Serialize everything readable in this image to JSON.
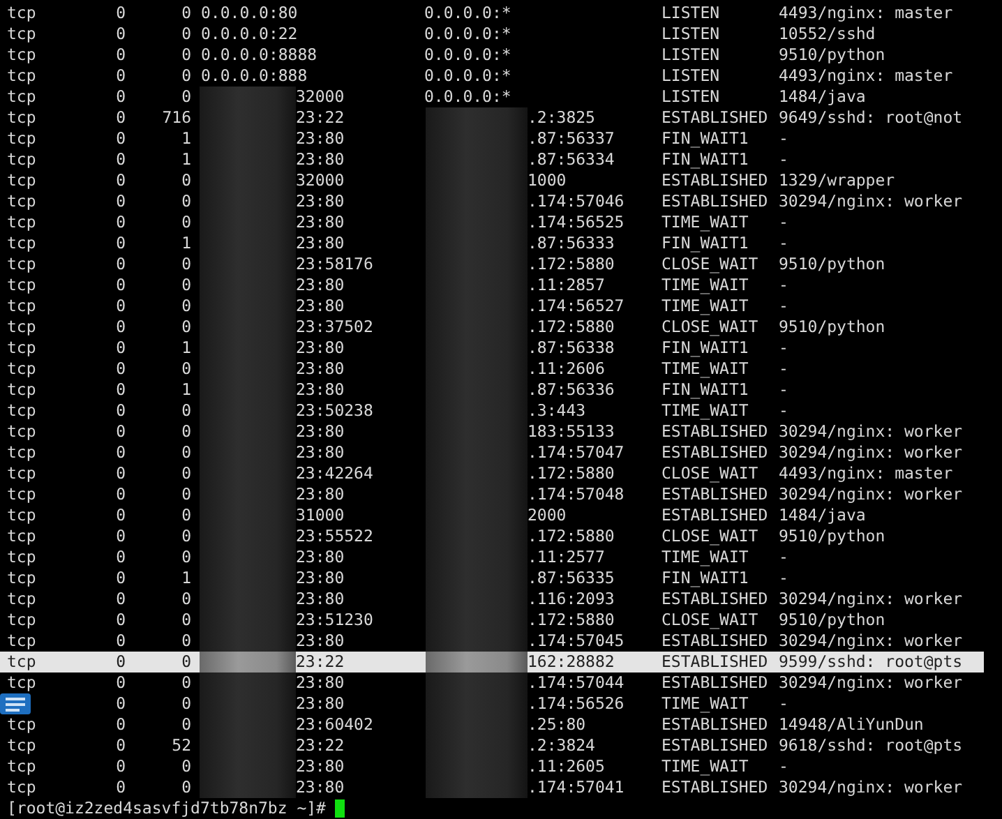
{
  "terminal": {
    "rows": [
      {
        "proto": "tcp",
        "recv_q": "0",
        "send_q": "0",
        "local": "0.0.0.0:80",
        "local_redacted": false,
        "foreign": "0.0.0.0:*",
        "foreign_redacted": false,
        "state": "LISTEN",
        "program": "4493/nginx: master",
        "selected": false
      },
      {
        "proto": "tcp",
        "recv_q": "0",
        "send_q": "0",
        "local": "0.0.0.0:22",
        "local_redacted": false,
        "foreign": "0.0.0.0:*",
        "foreign_redacted": false,
        "state": "LISTEN",
        "program": "10552/sshd",
        "selected": false
      },
      {
        "proto": "tcp",
        "recv_q": "0",
        "send_q": "0",
        "local": "0.0.0.0:8888",
        "local_redacted": false,
        "foreign": "0.0.0.0:*",
        "foreign_redacted": false,
        "state": "LISTEN",
        "program": "9510/python",
        "selected": false
      },
      {
        "proto": "tcp",
        "recv_q": "0",
        "send_q": "0",
        "local": "0.0.0.0:888",
        "local_redacted": false,
        "foreign": "0.0.0.0:*",
        "foreign_redacted": false,
        "state": "LISTEN",
        "program": "4493/nginx: master",
        "selected": false
      },
      {
        "proto": "tcp",
        "recv_q": "0",
        "send_q": "0",
        "local": "32000",
        "local_redacted": true,
        "foreign": "0.0.0.0:*",
        "foreign_redacted": false,
        "state": "LISTEN",
        "program": "1484/java",
        "selected": false
      },
      {
        "proto": "tcp",
        "recv_q": "0",
        "send_q": "716",
        "local": "23:22",
        "local_redacted": true,
        "foreign": ".2:3825",
        "foreign_redacted": true,
        "state": "ESTABLISHED",
        "program": "9649/sshd: root@not",
        "selected": false
      },
      {
        "proto": "tcp",
        "recv_q": "0",
        "send_q": "1",
        "local": "23:80",
        "local_redacted": true,
        "foreign": ".87:56337",
        "foreign_redacted": true,
        "state": "FIN_WAIT1",
        "program": "-",
        "selected": false
      },
      {
        "proto": "tcp",
        "recv_q": "0",
        "send_q": "1",
        "local": "23:80",
        "local_redacted": true,
        "foreign": ".87:56334",
        "foreign_redacted": true,
        "state": "FIN_WAIT1",
        "program": "-",
        "selected": false
      },
      {
        "proto": "tcp",
        "recv_q": "0",
        "send_q": "0",
        "local": "32000",
        "local_redacted": true,
        "foreign": "1000",
        "foreign_redacted": true,
        "state": "ESTABLISHED",
        "program": "1329/wrapper",
        "selected": false
      },
      {
        "proto": "tcp",
        "recv_q": "0",
        "send_q": "0",
        "local": "23:80",
        "local_redacted": true,
        "foreign": ".174:57046",
        "foreign_redacted": true,
        "state": "ESTABLISHED",
        "program": "30294/nginx: worker",
        "selected": false
      },
      {
        "proto": "tcp",
        "recv_q": "0",
        "send_q": "0",
        "local": "23:80",
        "local_redacted": true,
        "foreign": ".174:56525",
        "foreign_redacted": true,
        "state": "TIME_WAIT",
        "program": "-",
        "selected": false
      },
      {
        "proto": "tcp",
        "recv_q": "0",
        "send_q": "1",
        "local": "23:80",
        "local_redacted": true,
        "foreign": ".87:56333",
        "foreign_redacted": true,
        "state": "FIN_WAIT1",
        "program": "-",
        "selected": false
      },
      {
        "proto": "tcp",
        "recv_q": "0",
        "send_q": "0",
        "local": "23:58176",
        "local_redacted": true,
        "foreign": ".172:5880",
        "foreign_redacted": true,
        "state": "CLOSE_WAIT",
        "program": "9510/python",
        "selected": false
      },
      {
        "proto": "tcp",
        "recv_q": "0",
        "send_q": "0",
        "local": "23:80",
        "local_redacted": true,
        "foreign": ".11:2857",
        "foreign_redacted": true,
        "state": "TIME_WAIT",
        "program": "-",
        "selected": false
      },
      {
        "proto": "tcp",
        "recv_q": "0",
        "send_q": "0",
        "local": "23:80",
        "local_redacted": true,
        "foreign": ".174:56527",
        "foreign_redacted": true,
        "state": "TIME_WAIT",
        "program": "-",
        "selected": false
      },
      {
        "proto": "tcp",
        "recv_q": "0",
        "send_q": "0",
        "local": "23:37502",
        "local_redacted": true,
        "foreign": ".172:5880",
        "foreign_redacted": true,
        "state": "CLOSE_WAIT",
        "program": "9510/python",
        "selected": false
      },
      {
        "proto": "tcp",
        "recv_q": "0",
        "send_q": "1",
        "local": "23:80",
        "local_redacted": true,
        "foreign": ".87:56338",
        "foreign_redacted": true,
        "state": "FIN_WAIT1",
        "program": "-",
        "selected": false
      },
      {
        "proto": "tcp",
        "recv_q": "0",
        "send_q": "0",
        "local": "23:80",
        "local_redacted": true,
        "foreign": ".11:2606",
        "foreign_redacted": true,
        "state": "TIME_WAIT",
        "program": "-",
        "selected": false
      },
      {
        "proto": "tcp",
        "recv_q": "0",
        "send_q": "1",
        "local": "23:80",
        "local_redacted": true,
        "foreign": ".87:56336",
        "foreign_redacted": true,
        "state": "FIN_WAIT1",
        "program": "-",
        "selected": false
      },
      {
        "proto": "tcp",
        "recv_q": "0",
        "send_q": "0",
        "local": "23:50238",
        "local_redacted": true,
        "foreign": ".3:443",
        "foreign_redacted": true,
        "state": "TIME_WAIT",
        "program": "-",
        "selected": false
      },
      {
        "proto": "tcp",
        "recv_q": "0",
        "send_q": "0",
        "local": "23:80",
        "local_redacted": true,
        "foreign": "183:55133",
        "foreign_redacted": true,
        "state": "ESTABLISHED",
        "program": "30294/nginx: worker",
        "selected": false
      },
      {
        "proto": "tcp",
        "recv_q": "0",
        "send_q": "0",
        "local": "23:80",
        "local_redacted": true,
        "foreign": ".174:57047",
        "foreign_redacted": true,
        "state": "ESTABLISHED",
        "program": "30294/nginx: worker",
        "selected": false
      },
      {
        "proto": "tcp",
        "recv_q": "0",
        "send_q": "0",
        "local": "23:42264",
        "local_redacted": true,
        "foreign": ".172:5880",
        "foreign_redacted": true,
        "state": "CLOSE_WAIT",
        "program": "4493/nginx: master",
        "selected": false
      },
      {
        "proto": "tcp",
        "recv_q": "0",
        "send_q": "0",
        "local": "23:80",
        "local_redacted": true,
        "foreign": ".174:57048",
        "foreign_redacted": true,
        "state": "ESTABLISHED",
        "program": "30294/nginx: worker",
        "selected": false
      },
      {
        "proto": "tcp",
        "recv_q": "0",
        "send_q": "0",
        "local": "31000",
        "local_redacted": true,
        "foreign": "2000",
        "foreign_redacted": true,
        "state": "ESTABLISHED",
        "program": "1484/java",
        "selected": false
      },
      {
        "proto": "tcp",
        "recv_q": "0",
        "send_q": "0",
        "local": "23:55522",
        "local_redacted": true,
        "foreign": ".172:5880",
        "foreign_redacted": true,
        "state": "CLOSE_WAIT",
        "program": "9510/python",
        "selected": false
      },
      {
        "proto": "tcp",
        "recv_q": "0",
        "send_q": "0",
        "local": "23:80",
        "local_redacted": true,
        "foreign": ".11:2577",
        "foreign_redacted": true,
        "state": "TIME_WAIT",
        "program": "-",
        "selected": false
      },
      {
        "proto": "tcp",
        "recv_q": "0",
        "send_q": "1",
        "local": "23:80",
        "local_redacted": true,
        "foreign": ".87:56335",
        "foreign_redacted": true,
        "state": "FIN_WAIT1",
        "program": "-",
        "selected": false
      },
      {
        "proto": "tcp",
        "recv_q": "0",
        "send_q": "0",
        "local": "23:80",
        "local_redacted": true,
        "foreign": ".116:2093",
        "foreign_redacted": true,
        "state": "ESTABLISHED",
        "program": "30294/nginx: worker",
        "selected": false
      },
      {
        "proto": "tcp",
        "recv_q": "0",
        "send_q": "0",
        "local": "23:51230",
        "local_redacted": true,
        "foreign": ".172:5880",
        "foreign_redacted": true,
        "state": "CLOSE_WAIT",
        "program": "9510/python",
        "selected": false
      },
      {
        "proto": "tcp",
        "recv_q": "0",
        "send_q": "0",
        "local": "23:80",
        "local_redacted": true,
        "foreign": ".174:57045",
        "foreign_redacted": true,
        "state": "ESTABLISHED",
        "program": "30294/nginx: worker",
        "selected": false
      },
      {
        "proto": "tcp",
        "recv_q": "0",
        "send_q": "0",
        "local": "23:22",
        "local_redacted": true,
        "foreign": "162:28882",
        "foreign_redacted": true,
        "state": "ESTABLISHED",
        "program": "9599/sshd: root@pts",
        "selected": true
      },
      {
        "proto": "tcp",
        "recv_q": "0",
        "send_q": "0",
        "local": "23:80",
        "local_redacted": true,
        "foreign": ".174:57044",
        "foreign_redacted": true,
        "state": "ESTABLISHED",
        "program": "30294/nginx: worker",
        "selected": false
      },
      {
        "recv_q": "0",
        "send_q": "0",
        "local": "23:80",
        "local_redacted": true,
        "foreign": ".174:56526",
        "foreign_redacted": true,
        "state": "TIME_WAIT",
        "program": "-",
        "selected": false
      },
      {
        "proto": "tcp",
        "recv_q": "0",
        "send_q": "0",
        "local": "23:60402",
        "local_redacted": true,
        "foreign": ".25:80",
        "foreign_redacted": true,
        "state": "ESTABLISHED",
        "program": "14948/AliYunDun",
        "selected": false
      },
      {
        "proto": "tcp",
        "recv_q": "0",
        "send_q": "52",
        "local": "23:22",
        "local_redacted": true,
        "foreign": ".2:3824",
        "foreign_redacted": true,
        "state": "ESTABLISHED",
        "program": "9618/sshd: root@pts",
        "selected": false
      },
      {
        "proto": "tcp",
        "recv_q": "0",
        "send_q": "0",
        "local": "23:80",
        "local_redacted": true,
        "foreign": ".11:2605",
        "foreign_redacted": true,
        "state": "TIME_WAIT",
        "program": "-",
        "selected": false
      },
      {
        "proto": "tcp",
        "recv_q": "0",
        "send_q": "0",
        "local": "23:80",
        "local_redacted": true,
        "foreign": ".174:57041",
        "foreign_redacted": true,
        "state": "ESTABLISHED",
        "program": "30294/nginx: worker",
        "selected": false
      }
    ],
    "prompt": "[root@iz2zed4sasvfjd7tb78n7bz ~]#"
  }
}
